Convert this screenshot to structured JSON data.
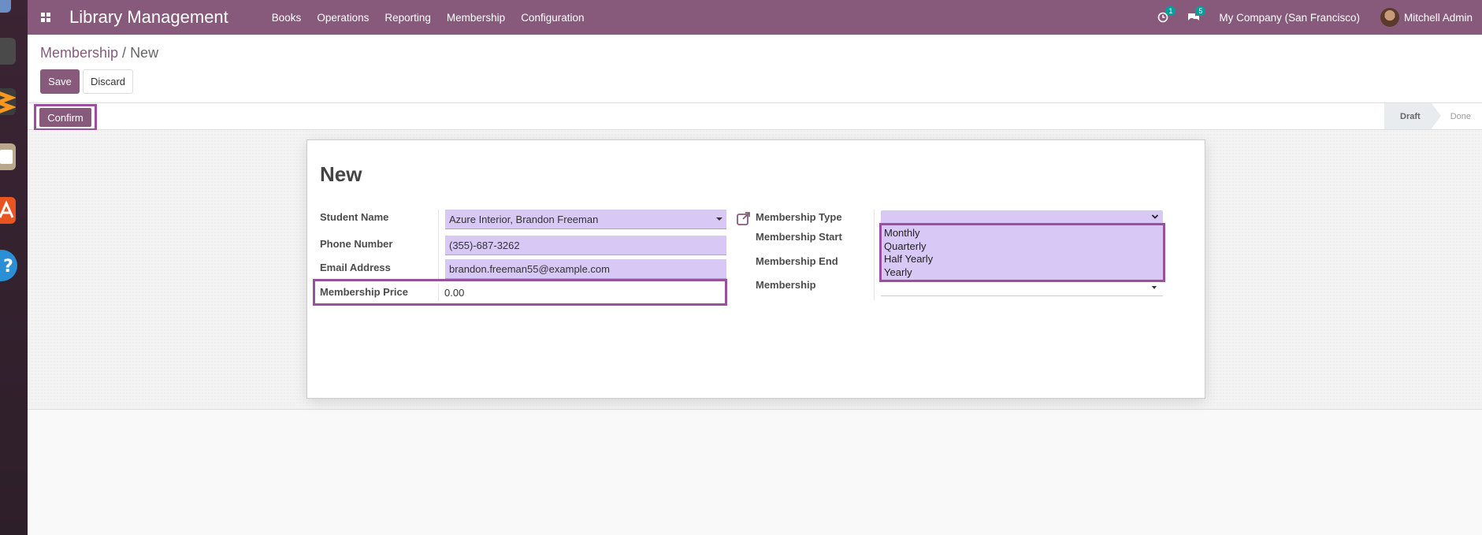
{
  "navbar": {
    "app_title": "Library Management",
    "menu": [
      "Books",
      "Operations",
      "Reporting",
      "Membership",
      "Configuration"
    ],
    "activity_badge": "1",
    "messages_badge": "5",
    "company": "My Company (San Francisco)",
    "user": "Mitchell Admin",
    "color": "#875a7b"
  },
  "breadcrumb": {
    "parent": "Membership",
    "separator": "/",
    "current": "New"
  },
  "buttons": {
    "save": "Save",
    "discard": "Discard",
    "confirm": "Confirm"
  },
  "statusbar": {
    "stages": [
      "Draft",
      "Done"
    ],
    "active_stage": "Draft"
  },
  "form": {
    "title": "New",
    "left": {
      "student_name_label": "Student Name",
      "student_name_value": "Azure Interior, Brandon Freeman",
      "phone_label": "Phone Number",
      "phone_value": "(355)-687-3262",
      "email_label": "Email Address",
      "email_value": "brandon.freeman55@example.com",
      "price_label": "Membership Price",
      "price_value": "0.00"
    },
    "right": {
      "type_label": "Membership Type",
      "type_value": "",
      "start_label": "Membership Start",
      "end_label": "Membership End",
      "membership_label": "Membership",
      "membership_value": ""
    },
    "type_options": [
      "Monthly",
      "Quarterly",
      "Half Yearly",
      "Yearly"
    ]
  },
  "icons": [
    "apps-grid-icon",
    "activity-clock-icon",
    "chat-bubbles-icon",
    "external-link-icon",
    "chevron-down-icon"
  ]
}
